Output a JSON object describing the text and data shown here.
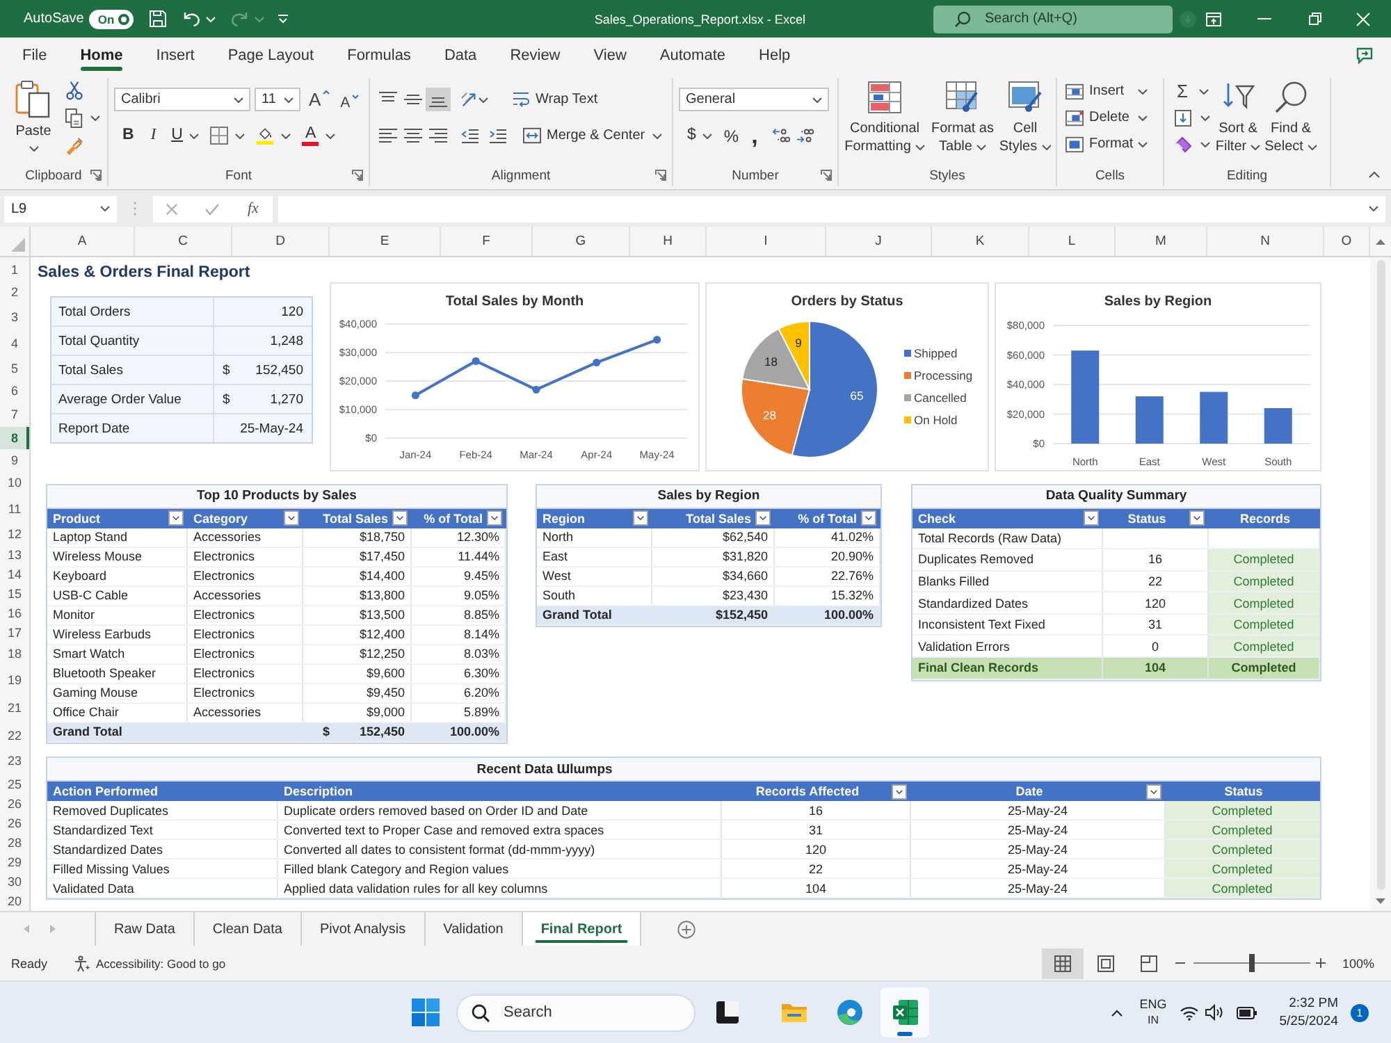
{
  "title_bar": {
    "autosave_label": "AutoSave",
    "autosave": {
      "label": "On",
      "on": true
    },
    "redo_disabled": true,
    "title": "Sales_Operations_Report.xlsx - Excel",
    "search": {
      "placeholder": "Search (Alt+Q)"
    }
  },
  "ribbon_tabs": [
    {
      "label": "File",
      "selected": false
    },
    {
      "label": "Home",
      "selected": true
    },
    {
      "label": "Insert",
      "selected": false
    },
    {
      "label": "Page Layout",
      "selected": false
    },
    {
      "label": "Formulas",
      "selected": false
    },
    {
      "label": "Data",
      "selected": false
    },
    {
      "label": "Review",
      "selected": false
    },
    {
      "label": "View",
      "selected": false
    },
    {
      "label": "Automate",
      "selected": false
    },
    {
      "label": "Help",
      "selected": false
    }
  ],
  "ribbon": {
    "clipboard": {
      "label": "Clipboard",
      "paste": "Paste"
    },
    "font": {
      "label": "Font",
      "font_name": "Calibri",
      "font_size": "11",
      "grow": "A",
      "shrink": "A",
      "bold": "B",
      "italic": "I",
      "underline": "U",
      "font_color": "A"
    },
    "alignment": {
      "label": "Alignment",
      "vertical": [
        {
          "kind": "top",
          "selected": false
        },
        {
          "kind": "middle",
          "selected": false
        },
        {
          "kind": "bottom",
          "selected": true
        }
      ],
      "wrap_text": "Wrap Text",
      "merge": "Merge & Center"
    },
    "number": {
      "label": "Number",
      "format": "General",
      "currency": "$",
      "percent": "%",
      "comma": ","
    },
    "styles": {
      "label": "Styles",
      "buttons": [
        {
          "kind": "conditional",
          "lines": [
            "Conditional",
            "Formatting"
          ]
        },
        {
          "kind": "table",
          "lines": [
            "Format as",
            "Table"
          ]
        },
        {
          "kind": "cell",
          "lines": [
            "Cell",
            "Styles"
          ]
        }
      ]
    },
    "cells": {
      "label": "Cells",
      "buttons": [
        {
          "kind": "insert",
          "label": "Insert"
        },
        {
          "kind": "delete",
          "label": "Delete"
        },
        {
          "kind": "format",
          "label": "Format"
        }
      ]
    },
    "editing": {
      "label": "Editing",
      "autosum": "Σ",
      "buttons": [
        {
          "kind": "sort",
          "lines": [
            "Sort &",
            "Filter"
          ]
        },
        {
          "kind": "find",
          "lines": [
            "Find &",
            "Select"
          ]
        }
      ]
    }
  },
  "formula_bar": {
    "name_box": "L9",
    "function_label": "fx"
  },
  "column_headers": [
    "A",
    "C",
    "D",
    "E",
    "F",
    "G",
    "H",
    "I",
    "J",
    "K",
    "L",
    "M",
    "N",
    "O"
  ],
  "row_headers": [
    {
      "label": "1",
      "selected": false
    },
    {
      "label": "2",
      "selected": false
    },
    {
      "label": "3",
      "selected": false
    },
    {
      "label": "4",
      "selected": false
    },
    {
      "label": "5",
      "selected": false
    },
    {
      "label": "6",
      "selected": false
    },
    {
      "label": "7",
      "selected": false
    },
    {
      "label": "8",
      "selected": true
    },
    {
      "label": "9",
      "selected": false
    },
    {
      "label": "10",
      "selected": false
    },
    {
      "label": "11",
      "selected": false
    },
    {
      "label": "12",
      "selected": false
    },
    {
      "label": "13",
      "selected": false
    },
    {
      "label": "14",
      "selected": false
    },
    {
      "label": "15",
      "selected": false
    },
    {
      "label": "16",
      "selected": false
    },
    {
      "label": "17",
      "selected": false
    },
    {
      "label": "18",
      "selected": false
    },
    {
      "label": "19",
      "selected": false
    },
    {
      "label": "21",
      "selected": false
    },
    {
      "label": "22",
      "selected": false
    },
    {
      "label": "23",
      "selected": false
    },
    {
      "label": "25",
      "selected": false
    },
    {
      "label": "26",
      "selected": false
    },
    {
      "label": "26",
      "selected": false
    },
    {
      "label": "28",
      "selected": false
    },
    {
      "label": "29",
      "selected": false
    },
    {
      "label": "30",
      "selected": false
    },
    {
      "label": "20",
      "selected": false
    }
  ],
  "sheet": {
    "title": "Sales & Orders Final Report",
    "kpis": [
      {
        "label": "Total Orders",
        "value": "120"
      },
      {
        "label": "Total Quantity",
        "value": "1,248"
      },
      {
        "label": "Total Sales",
        "currency": "$",
        "value": "152,450"
      },
      {
        "label": "Average Order Value",
        "currency": "$",
        "value": "1,270"
      },
      {
        "label": "Report Date",
        "value": "25-May-24"
      }
    ],
    "charts": [
      {
        "chart_data": {
          "type": "line",
          "title": "Total Sales by Month",
          "categories": [
            "Jan-24",
            "Feb-24",
            "Mar-24",
            "Apr-24",
            "May-24"
          ],
          "values": [
            15000,
            27000,
            17000,
            26500,
            34500
          ],
          "color": "#4472c4",
          "ylim": [
            0,
            40000
          ],
          "yticks": [
            {
              "value": 0,
              "label": "$0"
            },
            {
              "value": 10000,
              "label": "$10,000"
            },
            {
              "value": 20000,
              "label": "$20,000"
            },
            {
              "value": 30000,
              "label": "$30,000"
            },
            {
              "value": 40000,
              "label": "$40,000"
            }
          ],
          "grid": true,
          "marker": "circle"
        }
      },
      {
        "chart_data": {
          "type": "pie",
          "title": "Orders by Status",
          "categories": [
            "Shipped",
            "Processing",
            "Cancelled",
            "On Hold"
          ],
          "values": [
            65,
            28,
            18,
            9
          ],
          "colors": [
            "#4472c4",
            "#ed7d31",
            "#a5a5a5",
            "#ffc000"
          ],
          "data_labels": true,
          "legend": "right"
        }
      },
      {
        "chart_data": {
          "type": "bar",
          "title": "Sales by Region",
          "categories": [
            "North",
            "East",
            "West",
            "South"
          ],
          "values": [
            63000,
            32000,
            35000,
            24000
          ],
          "color": "#4472c4",
          "ylim": [
            0,
            80000
          ],
          "yticks": [
            {
              "value": 0,
              "label": "$0"
            },
            {
              "value": 20000,
              "label": "$20,000"
            },
            {
              "value": 40000,
              "label": "$40,000"
            },
            {
              "value": 60000,
              "label": "$60,000"
            },
            {
              "value": 80000,
              "label": "$80,000"
            }
          ],
          "grid": true
        }
      }
    ],
    "tables": [
      {
        "title": "Top 10 Products by Sales",
        "columns": [
          {
            "label": "Product",
            "kind": "text",
            "filter": true
          },
          {
            "label": "Category",
            "kind": "text",
            "filter": true
          },
          {
            "label": "Total Sales",
            "kind": "amount",
            "filter": true
          },
          {
            "label": "% of Total",
            "kind": "amount",
            "filter": true
          }
        ],
        "rows": [
          [
            "Laptop Stand",
            "Accessories",
            "$18,750",
            "12.30%"
          ],
          [
            "Wireless Mouse",
            "Electronics",
            "$17,450",
            "11.44%"
          ],
          [
            "Keyboard",
            "Electronics",
            "$14,400",
            "9.45%"
          ],
          [
            "USB-C Cable",
            "Accessories",
            "$13,800",
            "9.05%"
          ],
          [
            "Monitor",
            "Electronics",
            "$13,500",
            "8.85%"
          ],
          [
            "Wireless Earbuds",
            "Electronics",
            "$12,400",
            "8.14%"
          ],
          [
            "Smart Watch",
            "Electronics",
            "$12,250",
            "8.03%"
          ],
          [
            "Bluetooth Speaker",
            "Electronics",
            "$9,600",
            "6.30%"
          ],
          [
            "Gaming Mouse",
            "Electronics",
            "$9,450",
            "6.20%"
          ],
          [
            "Office Chair",
            "Accessories",
            "$9,000",
            "5.89%"
          ]
        ],
        "total_row": {
          "kind": "grand_total",
          "cells": [
            "Grand Total",
            null,
            {
              "currency": "$",
              "value": "152,450"
            },
            "100.00%"
          ]
        }
      },
      {
        "title": "Sales by Region",
        "columns": [
          {
            "label": "Region",
            "kind": "text",
            "filter": true
          },
          {
            "label": "Total Sales",
            "kind": "amount",
            "filter": true
          },
          {
            "label": "% of Total",
            "kind": "amount",
            "filter": true
          }
        ],
        "rows": [
          [
            "North",
            "$62,540",
            "41.02%"
          ],
          [
            "East",
            "$31,820",
            "20.90%"
          ],
          [
            "West",
            "$34,660",
            "22.76%"
          ],
          [
            "South",
            "$23,430",
            "15.32%"
          ]
        ],
        "total_row": {
          "kind": "grand_total",
          "cells": [
            "Grand Total",
            "$152,450",
            "100.00%"
          ]
        }
      },
      {
        "title": "Data Quality Summary",
        "columns": [
          {
            "label": "Check",
            "kind": "text",
            "filter": true
          },
          {
            "label": "Status",
            "kind": "count",
            "filter": true
          },
          {
            "label": "Records",
            "kind": "status",
            "filter": false
          }
        ],
        "rows": [
          [
            "Total Records (Raw Data)",
            null,
            null
          ],
          [
            "Duplicates Removed",
            "16",
            "Completed"
          ],
          [
            "Blanks Filled",
            "22",
            "Completed"
          ],
          [
            "Standardized Dates",
            "120",
            "Completed"
          ],
          [
            "Inconsistent Text Fixed",
            "31",
            "Completed"
          ],
          [
            "Validation Errors",
            "0",
            "Completed"
          ]
        ],
        "total_row": {
          "kind": "final",
          "cells": [
            "Final Clean Records",
            "104",
            "Completed"
          ]
        }
      },
      {
        "title": "Recent Data Ɯlɯmps",
        "columns": [
          {
            "label": "Action Performed",
            "kind": "text",
            "filter": false
          },
          {
            "label": "Description",
            "kind": "text",
            "filter": false
          },
          {
            "label": "Records Affected",
            "kind": "count",
            "filter": true
          },
          {
            "label": "Date",
            "kind": "date",
            "filter": true
          },
          {
            "label": "Status",
            "kind": "status",
            "filter": false
          }
        ],
        "rows": [
          [
            "Removed Duplicates",
            "Duplicate orders removed based on Order ID and Date",
            "16",
            "25-May-24",
            "Completed"
          ],
          [
            "Standardized Text",
            "Converted text to Proper Case and removed extra spaces",
            "31",
            "25-May-24",
            "Completed"
          ],
          [
            "Standardized Dates",
            "Converted all dates to consistent format (dd-mmm-yyyy)",
            "120",
            "25-May-24",
            "Completed"
          ],
          [
            "Filled Missing Values",
            "Filled blank Category and Region values",
            "22",
            "25-May-24",
            "Completed"
          ],
          [
            "Validated Data",
            "Applied data validation rules for all key columns",
            "104",
            "25-May-24",
            "Completed"
          ]
        ]
      }
    ]
  },
  "sheet_tabs": [
    {
      "label": "Raw Data",
      "selected": false
    },
    {
      "label": "Clean Data",
      "selected": false
    },
    {
      "label": "Pivot Analysis",
      "selected": false
    },
    {
      "label": "Validation",
      "selected": false
    },
    {
      "label": "Final Report",
      "selected": true
    }
  ],
  "status_bar": {
    "mode": "Ready",
    "accessibility": "Accessibility: Good to go",
    "views": [
      {
        "kind": "normal",
        "selected": true
      },
      {
        "kind": "page_layout",
        "selected": false
      },
      {
        "kind": "page_break",
        "selected": false
      }
    ],
    "zoom": {
      "level": 0.5,
      "reading": "100%"
    }
  },
  "taskbar": {
    "search": {
      "placeholder": "Search"
    },
    "apps": [
      {
        "kind": "task_view",
        "selected": false
      },
      {
        "kind": "files",
        "selected": false
      },
      {
        "kind": "browser",
        "selected": false
      },
      {
        "kind": "spreadsheet",
        "selected": true
      }
    ],
    "language": "ENG",
    "region": "IN",
    "time": "2:32 PM",
    "date": "5/25/2024",
    "notifications": "1"
  }
}
